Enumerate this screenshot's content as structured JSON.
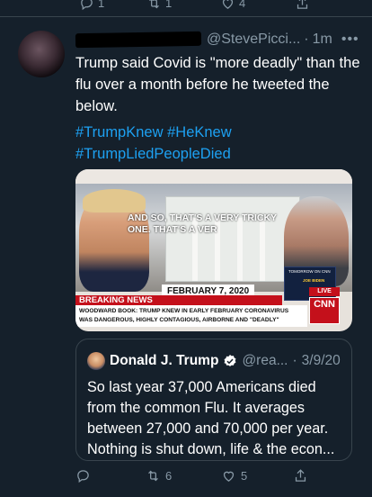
{
  "previous_tweet": {
    "reply_count": "1",
    "retweet_count": "1",
    "like_count": "4"
  },
  "tweet": {
    "display_handle": "@StevePicci...",
    "separator": "·",
    "time": "1m",
    "more": "•••",
    "text": "Trump said Covid is \"more deadly\" than the flu over a month before he tweeted the below.",
    "hashtags": [
      {
        "label": "#TrumpKnew"
      },
      {
        "label": "#HeKnew"
      },
      {
        "label": "#TrumpLiedPeopleDied"
      }
    ]
  },
  "media": {
    "quote_line1": "AND SO, THAT'S A VERY TRICKY",
    "quote_line2": "ONE. THAT'S A VER",
    "date_caption": "FEBRUARY 7, 2020",
    "breaking_label": "BREAKING NEWS",
    "ticker_line1": "WOODWARD BOOK: TRUMP KNEW IN EARLY FEBRUARY CORONAVIRUS",
    "ticker_line2": "WAS DANGEROUS, HIGHLY CONTAGIOUS, AIRBORNE AND \"DEADLY\"",
    "promo_top": "TOMORROW ON CNN",
    "promo_name": "JOE BIDEN",
    "promo_time": "4P",
    "live_label": "LIVE",
    "network": "CNN"
  },
  "quoted_tweet": {
    "name": "Donald J. Trump",
    "handle": "@rea...",
    "separator": "·",
    "date": "3/9/20",
    "text": "So last year 37,000 Americans died from the common Flu. It averages between 27,000 and 70,000 per year. Nothing is shut down, life & the econ..."
  },
  "actions": {
    "retweet_count": "6",
    "like_count": "5"
  },
  "colors": {
    "background": "#15202b",
    "link": "#1da1f2",
    "secondary_text": "#8899a6",
    "border": "#38444d",
    "verified": "#1da1f2"
  },
  "icons": [
    "reply-icon",
    "retweet-icon",
    "like-icon",
    "share-icon",
    "verified-icon"
  ]
}
